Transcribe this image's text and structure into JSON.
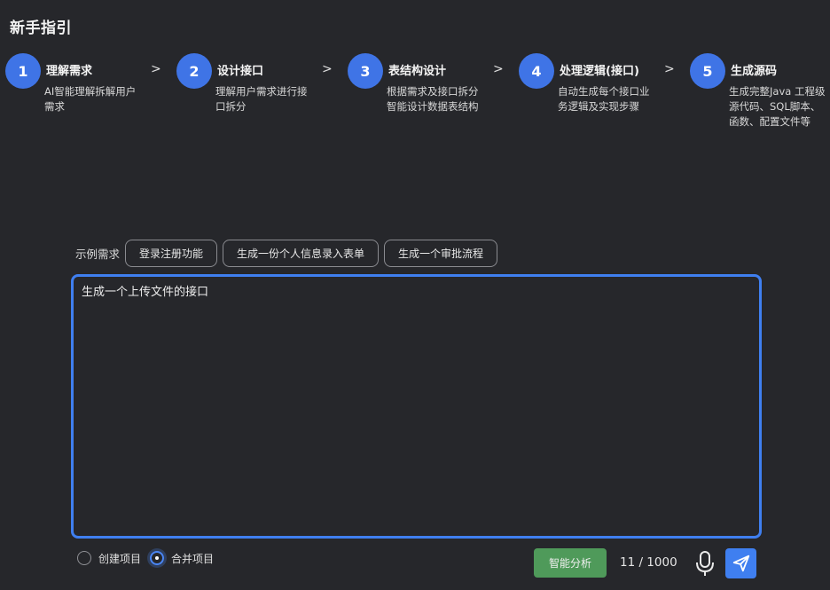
{
  "guide": {
    "title": "新手指引",
    "steps": [
      {
        "num": "1",
        "title": "理解需求",
        "desc": "AI智能理解拆解用户需求"
      },
      {
        "num": "2",
        "title": "设计接口",
        "desc": "理解用户需求进行接口拆分"
      },
      {
        "num": "3",
        "title": "表结构设计",
        "desc": "根据需求及接口拆分智能设计数据表结构"
      },
      {
        "num": "4",
        "title": "处理逻辑(接口)",
        "desc": "自动生成每个接口业务逻辑及实现步骤"
      },
      {
        "num": "5",
        "title": "生成源码",
        "desc": "生成完整Java 工程级源代码、SQL脚本、函数、配置文件等"
      }
    ],
    "arrow": ">"
  },
  "examples": {
    "label": "示例需求",
    "chips": [
      "登录注册功能",
      "生成一份个人信息录入表单",
      "生成一个审批流程"
    ]
  },
  "editor": {
    "value": "生成一个上传文件的接口"
  },
  "options": {
    "create_project": "创建项目",
    "merge_project": "合并项目",
    "selected": "merge_project"
  },
  "actions": {
    "analyze_label": "智能分析",
    "counter": "11 / 1000"
  },
  "colors": {
    "background": "#26272b",
    "accent": "#3f7ff0",
    "step_circle": "#3f74e6",
    "analyze_button": "#4f9a5a"
  },
  "icons": {
    "mic": "microphone-icon",
    "send": "send-icon"
  }
}
